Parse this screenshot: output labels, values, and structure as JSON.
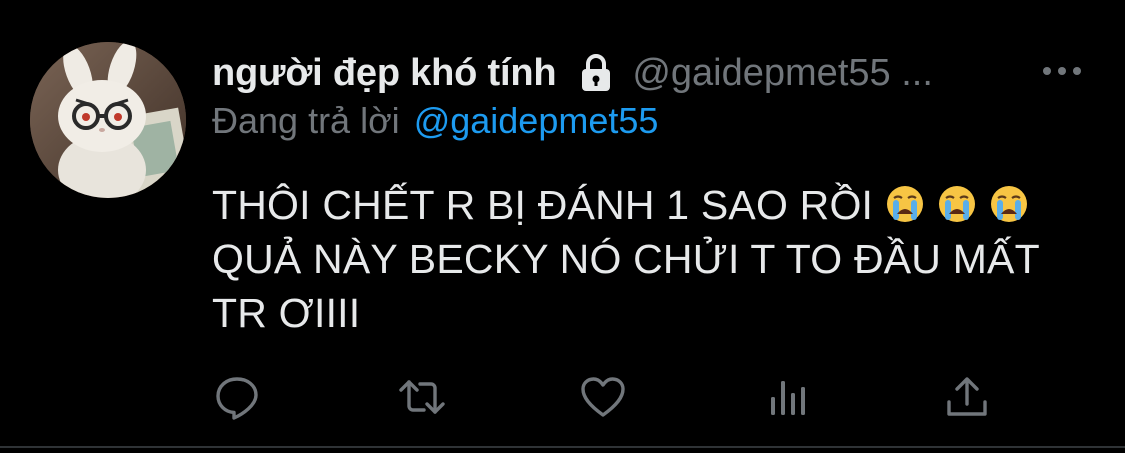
{
  "tweet": {
    "display_name": "người đẹp khó tính",
    "handle": "@gaidepmet55 ...",
    "reply_prefix": "Đang trả lời",
    "reply_handle": "@gaidepmet55",
    "text_lines": [
      "THÔI CHẾT R BỊ ĐÁNH 1 SAO RỒI",
      "QUẢ NÀY BECKY NÓ CHỬI T TO ĐẦU MẤT",
      "TR ƠIIII"
    ],
    "emojis": [
      "loudly-crying-face",
      "loudly-crying-face",
      "loudly-crying-face"
    ],
    "icons": {
      "lock": "lock-icon",
      "more": "more-icon",
      "reply": "reply-icon",
      "retweet": "retweet-icon",
      "like": "like-icon",
      "analytics": "analytics-icon",
      "share": "share-icon"
    }
  },
  "colors": {
    "background": "#000000",
    "text_primary": "#e7e9ea",
    "text_secondary": "#71767b",
    "link": "#1d9bf0",
    "divider": "#2f3336"
  }
}
